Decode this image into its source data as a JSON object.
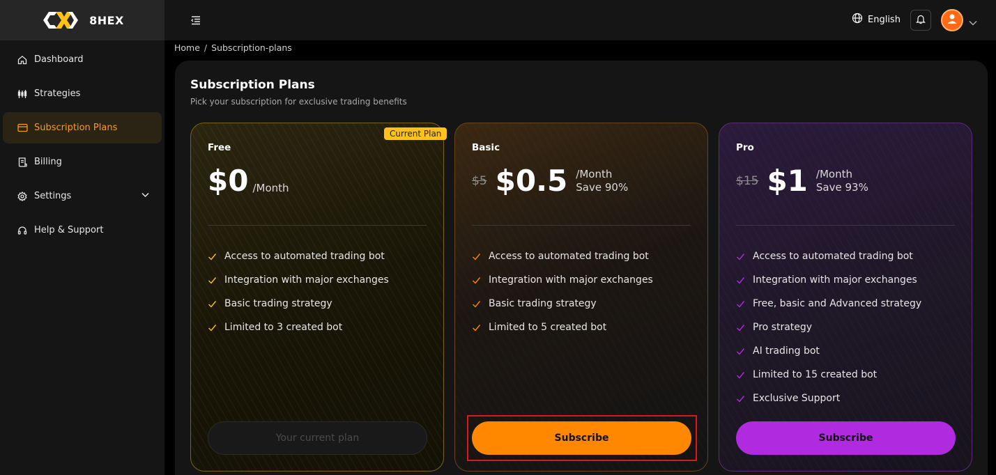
{
  "app": {
    "logo_text": "8HEX"
  },
  "sidebar": {
    "items": [
      {
        "label": "Dashboard",
        "icon": "home-icon"
      },
      {
        "label": "Strategies",
        "icon": "candles-icon"
      },
      {
        "label": "Subscription Plans",
        "icon": "card-icon",
        "active": true
      },
      {
        "label": "Billing",
        "icon": "receipt-icon"
      },
      {
        "label": "Settings",
        "icon": "gear-icon"
      },
      {
        "label": "Help & Support",
        "icon": "headset-icon"
      }
    ]
  },
  "topbar": {
    "language": "English"
  },
  "breadcrumb": {
    "home": "Home",
    "sep": "/",
    "current": "Subscription-plans"
  },
  "page": {
    "title": "Subscription Plans",
    "subtitle": "Pick your subscription for exclusive trading benefits"
  },
  "plans": [
    {
      "name": "Free",
      "price": "$0",
      "per": "/Month",
      "badge": "Current Plan",
      "features": [
        "Access to automated trading bot",
        "Integration with major exchanges",
        "Basic trading strategy",
        "Limited to 3 created bot"
      ],
      "button": "Your current plan"
    },
    {
      "name": "Basic",
      "old_price": "$5",
      "price": "$0.5",
      "per": "/Month",
      "save": "Save 90%",
      "features": [
        "Access to automated trading bot",
        "Integration with major exchanges",
        "Basic trading strategy",
        "Limited to 5 created bot"
      ],
      "button": "Subscribe"
    },
    {
      "name": "Pro",
      "old_price": "$15",
      "price": "$1",
      "per": "/Month",
      "save": "Save 93%",
      "features": [
        "Access to automated trading bot",
        "Integration with major exchanges",
        "Free, basic and Advanced strategy",
        "Pro strategy",
        "AI trading bot",
        "Limited to 15 created bot",
        "Exclusive Support"
      ],
      "button": "Subscribe"
    }
  ],
  "colors": {
    "accent": "#ff8800",
    "free": "#ffc21a",
    "pro": "#b02be0",
    "highlight": "#e0151d"
  }
}
